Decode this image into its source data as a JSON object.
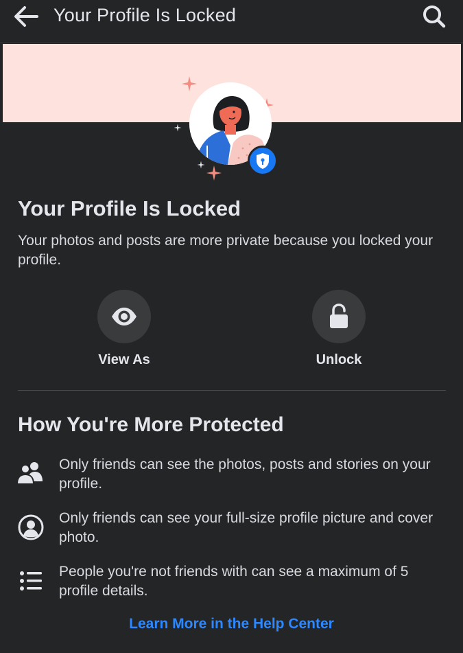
{
  "header": {
    "title": "Your Profile Is Locked",
    "back_icon": "arrow-left-icon",
    "search_icon": "search-icon"
  },
  "hero": {
    "avatar_icon": "woman-avatar",
    "badge_icon": "shield-lock-icon",
    "banner_color": "#fde2de",
    "accent_color": "#1877f2"
  },
  "main": {
    "title": "Your Profile Is Locked",
    "description": "Your photos and posts are more private because you locked your profile."
  },
  "actions": [
    {
      "label": "View As",
      "icon": "eye-icon"
    },
    {
      "label": "Unlock",
      "icon": "unlock-icon"
    }
  ],
  "protection": {
    "heading": "How You're More Protected",
    "items": [
      {
        "icon": "friends-icon",
        "text": "Only friends can see the photos, posts and stories on your profile."
      },
      {
        "icon": "profile-circle-icon",
        "text": "Only friends can see your full-size profile picture and cover photo."
      },
      {
        "icon": "list-icon",
        "text": "People you're not friends with can see a maximum of 5 profile details."
      }
    ]
  },
  "footer": {
    "help_link": "Learn More in the Help Center",
    "link_color": "#2d88ff"
  }
}
